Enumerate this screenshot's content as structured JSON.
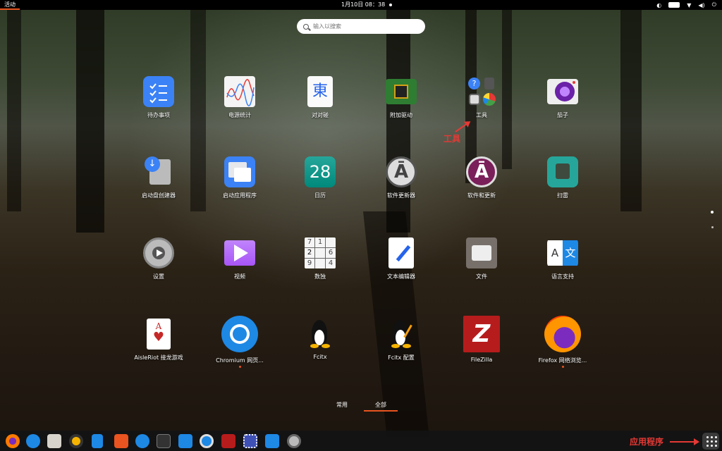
{
  "topbar": {
    "activities": "活动",
    "clock": "1月10日 08：38",
    "tray_icons": [
      "accessibility-icon",
      "keyboard-layout-icon",
      "network-icon",
      "volume-icon",
      "power-icon"
    ]
  },
  "search": {
    "placeholder": "输入以搜索"
  },
  "apps": [
    {
      "label": "待办事项"
    },
    {
      "label": "电源统计"
    },
    {
      "label": "对对碰"
    },
    {
      "label": "附加驱动"
    },
    {
      "label": "工具"
    },
    {
      "label": "茄子"
    },
    {
      "label": "启动盘创建器"
    },
    {
      "label": "启动应用程序"
    },
    {
      "label": "日历",
      "number": "28"
    },
    {
      "label": "软件更新器"
    },
    {
      "label": "软件和更新"
    },
    {
      "label": "扫雷"
    },
    {
      "label": "设置"
    },
    {
      "label": "视频"
    },
    {
      "label": "数独"
    },
    {
      "label": "文本编辑器"
    },
    {
      "label": "文件"
    },
    {
      "label": "语言支持"
    },
    {
      "label": "AisleRiot 接龙游戏"
    },
    {
      "label": "Chromium 网页..."
    },
    {
      "label": "Fcitx"
    },
    {
      "label": "Fcitx 配置"
    },
    {
      "label": "FileZilla"
    },
    {
      "label": "Firefox 网络浏览..."
    }
  ],
  "sudoku_digits": [
    "7",
    "1",
    "",
    "2",
    "",
    "6",
    "9",
    "",
    "4"
  ],
  "language_icon": {
    "left": "A",
    "right": "文"
  },
  "view_switcher": {
    "frequent": "常用",
    "all": "全部"
  },
  "annotations": {
    "tools": "工具",
    "apps": "应用程序"
  },
  "colors": {
    "accent": "#e95420",
    "annotation": "#e53935"
  }
}
